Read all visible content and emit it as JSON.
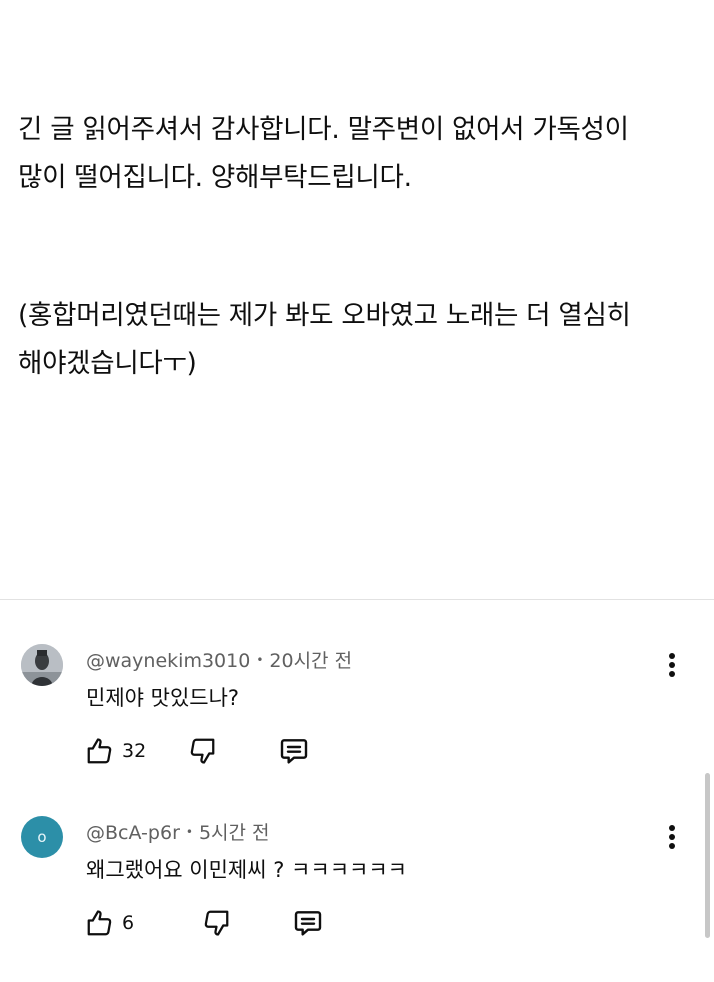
{
  "post": {
    "paragraph1": "긴 글 읽어주셔서 감사합니다. 말주변이 없어서 가독성이\n많이 떨어집니다. 양해부탁드립니다.",
    "paragraph2": "(홍합머리였던때는 제가 봐도 오바였고 노래는 더 열심히\n해야겠습니다ㅜ)"
  },
  "comments": [
    {
      "author": "@waynekim3010",
      "separator": "•",
      "time": "20시간 전",
      "text": "민제야 맛있드나?",
      "likes": "32",
      "avatar_type": "photo"
    },
    {
      "author": "@BcA-p6r",
      "separator": "•",
      "time": "5시간 전",
      "text": "왜그랬어요 이민제씨 ? ㅋㅋㅋㅋㅋㅋ",
      "likes": "6",
      "avatar_letter": "o",
      "avatar_color": "#2c8fa8"
    }
  ],
  "icons": {
    "like": "thumbs-up-icon",
    "dislike": "thumbs-down-icon",
    "reply": "comment-reply-icon",
    "menu": "more-vertical-icon"
  }
}
